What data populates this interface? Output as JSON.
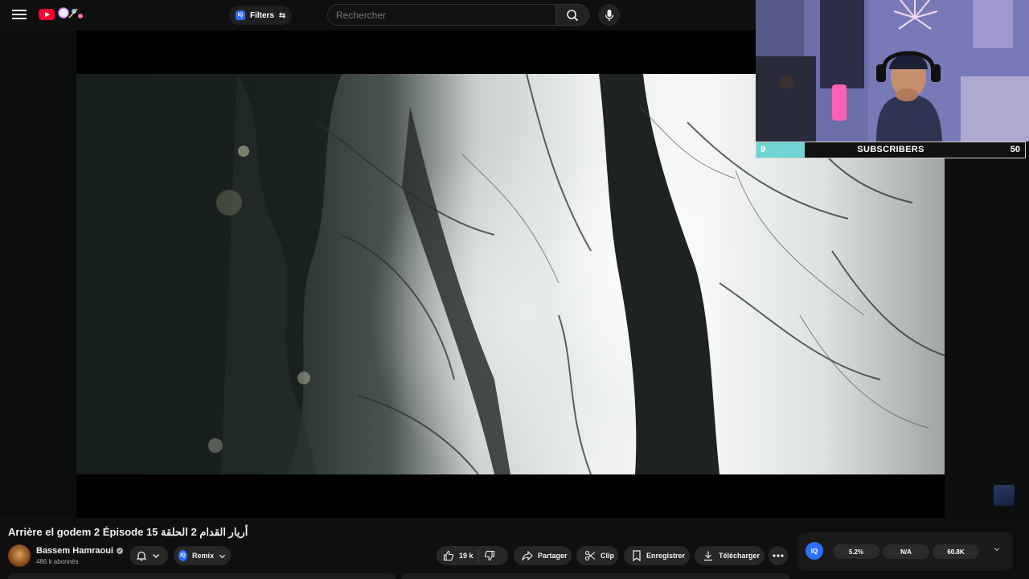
{
  "header": {
    "filters_label": "Filters",
    "filters_badge": "IQ",
    "search_placeholder": "Rechercher"
  },
  "webcam": {
    "sub_goal": {
      "current": "9",
      "label": "SUBSCRIBERS",
      "goal": "50",
      "progress": 0.18,
      "fill_color": "#6fd4d2"
    }
  },
  "video": {
    "title": "Arrière el godem 2 Épisode 15 أريار القدام 2 الحلقة",
    "channel": {
      "name": "Bassem Hamraoui",
      "subscribers": "486 k abonnés",
      "verified": true
    }
  },
  "actions": {
    "remix_badge": "IQ",
    "remix_label": "Remix",
    "likes": "19 k",
    "share": "Partager",
    "clip": "Clip",
    "save": "Enregistrer",
    "download": "Télécharger"
  },
  "stats_panel": {
    "badge": "IQ",
    "values": [
      "5.2%",
      "N/A",
      "60.8K"
    ]
  },
  "colors": {
    "background": "#0f0f0f",
    "brand_red": "#ff0033",
    "iq_blue": "#2f6fff",
    "pill_bg": "#272727"
  },
  "icons": [
    "menu-icon",
    "youtube-logo-icon",
    "filter-tune-icon",
    "search-icon",
    "mic-icon",
    "bell-icon",
    "chevron-down-icon",
    "like-icon",
    "dislike-icon",
    "share-icon",
    "scissors-icon",
    "bookmark-icon",
    "download-icon",
    "more-icon"
  ]
}
